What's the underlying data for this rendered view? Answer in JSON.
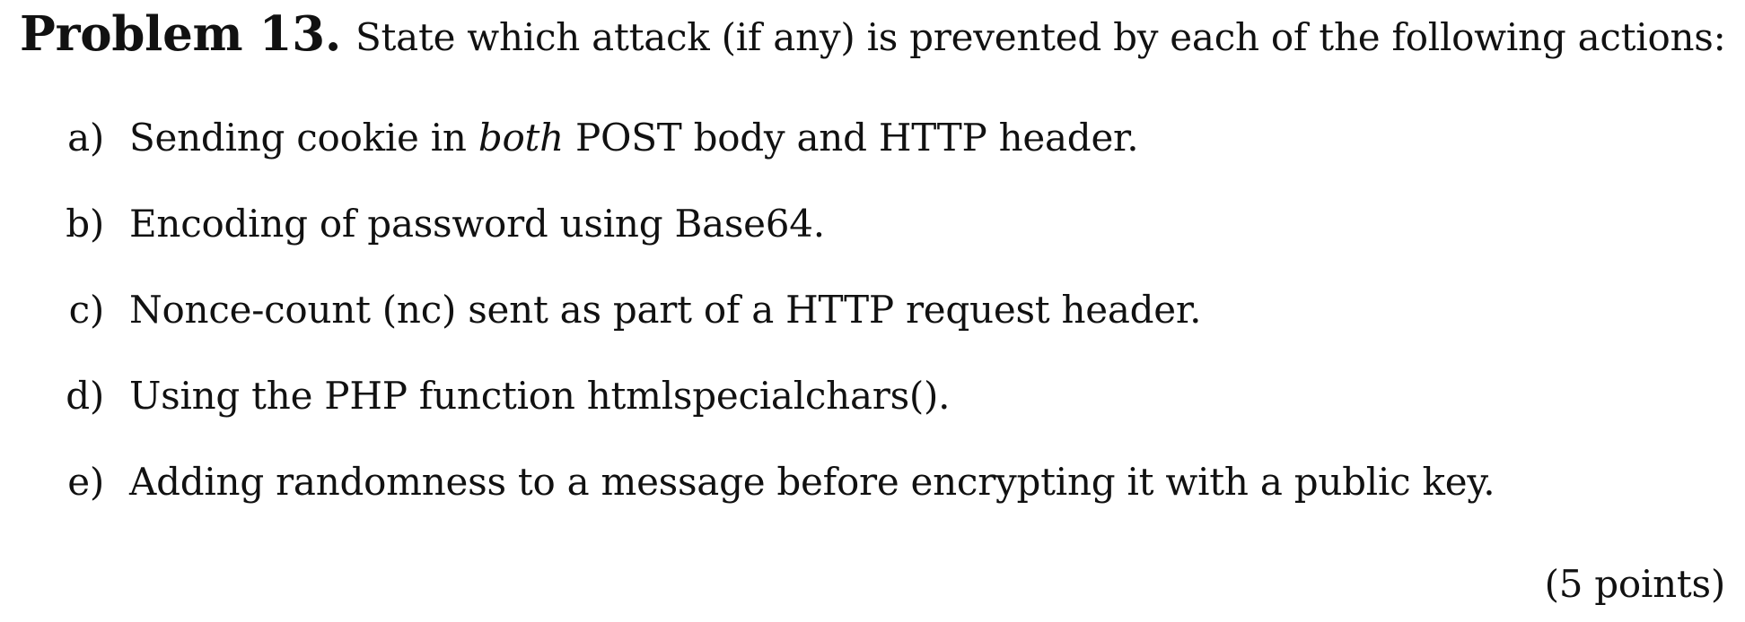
{
  "problem": {
    "label": "Problem 13.",
    "prompt": "State which attack (if any) is prevented by each of the following actions:",
    "points": "(5 points)"
  },
  "items": [
    {
      "letter": "a)",
      "text_before": "Sending cookie in ",
      "emphasis": "both",
      "text_after": " POST body and HTTP header."
    },
    {
      "letter": "b)",
      "text_before": "Encoding of password using Base64.",
      "emphasis": "",
      "text_after": ""
    },
    {
      "letter": "c)",
      "text_before": "Nonce-count (nc) sent as part of a HTTP request header.",
      "emphasis": "",
      "text_after": ""
    },
    {
      "letter": "d)",
      "text_before": "Using the PHP function htmlspecialchars().",
      "emphasis": "",
      "text_after": ""
    },
    {
      "letter": "e)",
      "text_before": "Adding randomness to a message before encrypting it with a public key.",
      "emphasis": "",
      "text_after": ""
    }
  ]
}
